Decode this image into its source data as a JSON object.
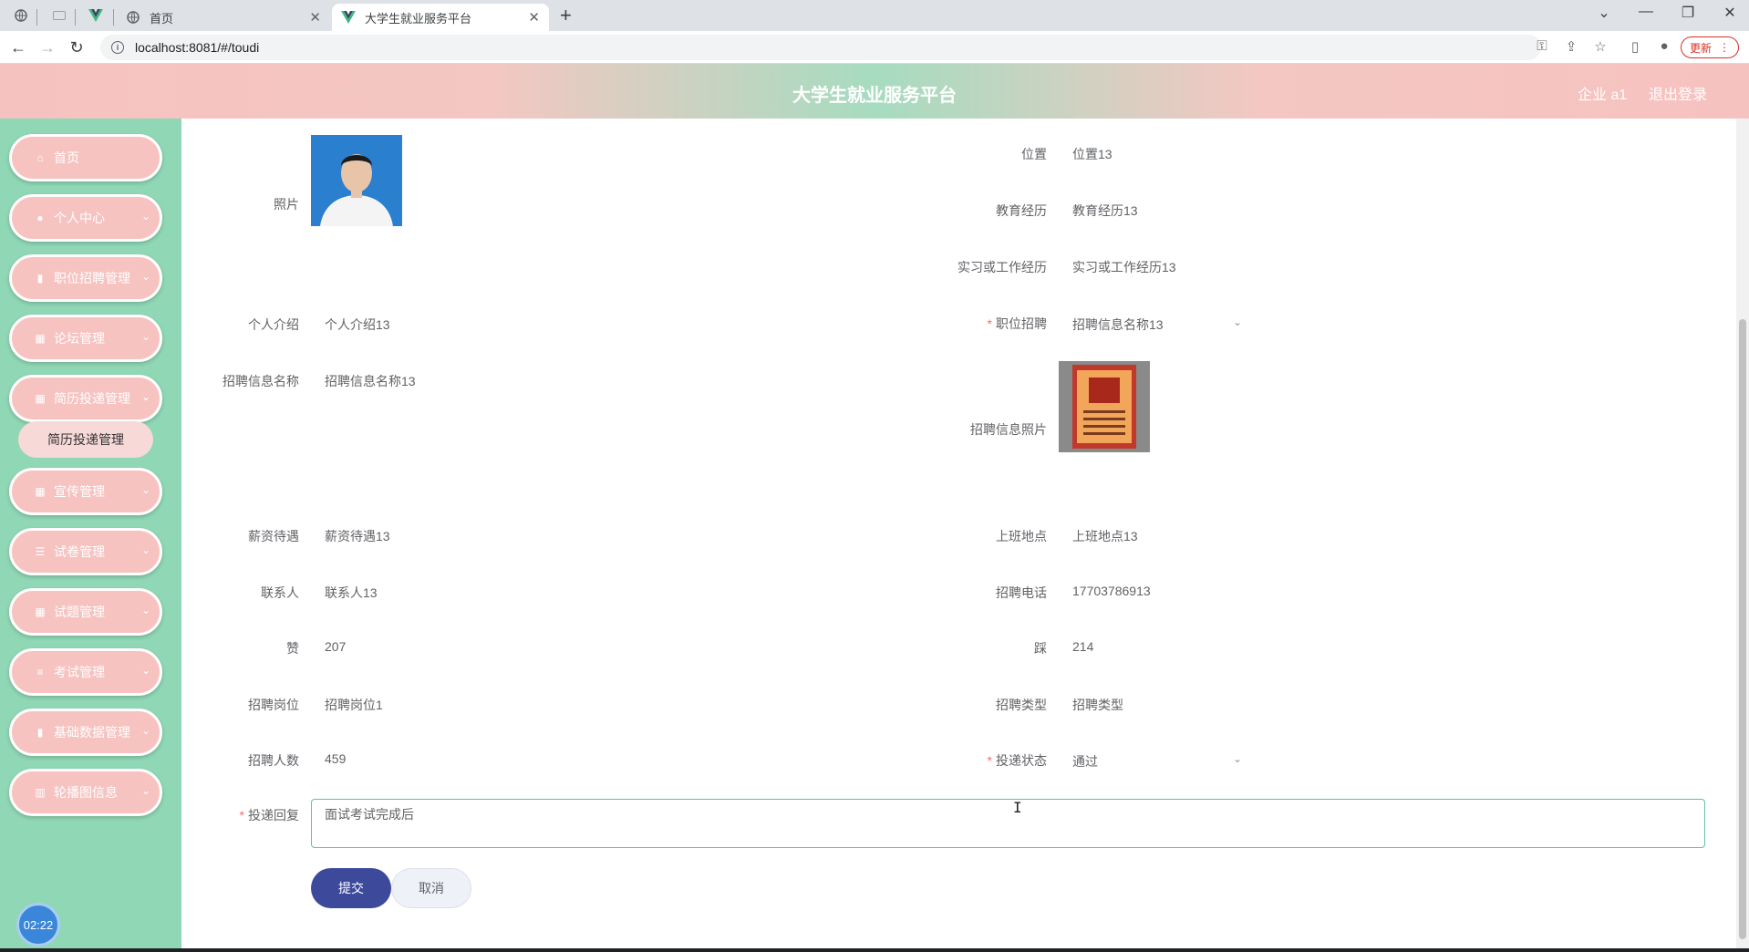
{
  "browser": {
    "tabs": [
      {
        "label": "首页",
        "active": false
      },
      {
        "label": "大学生就业服务平台",
        "active": true
      }
    ],
    "url": "localhost:8081/#/toudi",
    "update_label": "更新",
    "new_tab_icon": "+"
  },
  "header": {
    "title": "大学生就业服务平台",
    "user": "企业 a1",
    "logout": "退出登录"
  },
  "sidebar": {
    "items": [
      {
        "label": "首页",
        "icon": "home-icon"
      },
      {
        "label": "个人中心",
        "icon": "user-icon"
      },
      {
        "label": "职位招聘管理",
        "icon": "clipboard-icon"
      },
      {
        "label": "论坛管理",
        "icon": "grid-icon"
      },
      {
        "label": "简历投递管理",
        "icon": "grid-icon"
      },
      {
        "label": "宣传管理",
        "icon": "grid-icon"
      },
      {
        "label": "试卷管理",
        "icon": "sliders-icon"
      },
      {
        "label": "试题管理",
        "icon": "grid-icon"
      },
      {
        "label": "考试管理",
        "icon": "list-icon"
      },
      {
        "label": "基础数据管理",
        "icon": "clipboard-icon"
      },
      {
        "label": "轮播图信息",
        "icon": "chart-icon"
      }
    ],
    "submenu_active": "简历投递管理",
    "clock": "02:22"
  },
  "form": {
    "photo_label": "照片",
    "position_label": "位置",
    "position_value": "位置13",
    "education_label": "教育经历",
    "education_value": "教育经历13",
    "experience_label": "实习或工作经历",
    "experience_value": "实习或工作经历13",
    "intro_label": "个人介绍",
    "intro_value": "个人介绍13",
    "job_label": "职位招聘",
    "job_value": "招聘信息名称13",
    "recruit_name_label": "招聘信息名称",
    "recruit_name_value": "招聘信息名称13",
    "recruit_photo_label": "招聘信息照片",
    "salary_label": "薪资待遇",
    "salary_value": "薪资待遇13",
    "workplace_label": "上班地点",
    "workplace_value": "上班地点13",
    "contact_label": "联系人",
    "contact_value": "联系人13",
    "phone_label": "招聘电话",
    "phone_value": "17703786913",
    "likes_label": "赞",
    "likes_value": "207",
    "dislikes_label": "踩",
    "dislikes_value": "214",
    "post_label": "招聘岗位",
    "post_value": "招聘岗位1",
    "type_label": "招聘类型",
    "type_value": "招聘类型",
    "count_label": "招聘人数",
    "count_value": "459",
    "status_label": "投递状态",
    "status_value": "通过",
    "reply_label": "投递回复",
    "reply_value": "面试考试完成后",
    "required_mark": "*",
    "submit_label": "提交",
    "cancel_label": "取消"
  },
  "colors": {
    "sidebar_bg": "#8fd7b5",
    "menu_pink": "#f6c3c1",
    "submit_bg": "#3d4a9c",
    "textarea_border": "#5cc49a"
  }
}
